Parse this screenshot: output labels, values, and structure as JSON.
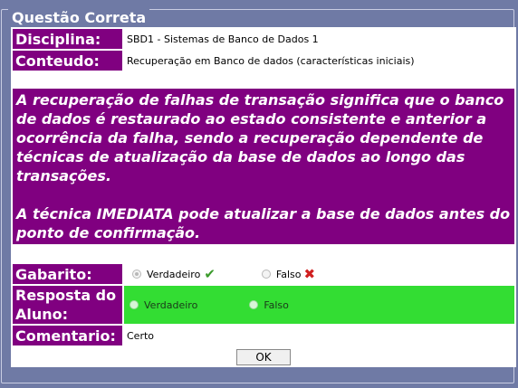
{
  "panel": {
    "title": "Questão Correta"
  },
  "fields": {
    "disciplina_label": "Disciplina:",
    "disciplina_value": "SBD1 - Sistemas de Banco de Dados 1",
    "conteudo_label": "Conteudo:",
    "conteudo_value": "Recuperação em Banco de dados (características iniciais)"
  },
  "question": {
    "paragraph1": "A recuperação de falhas de transação significa que o banco de dados é restaurado ao estado consistente e anterior a ocorrência da falha, sendo a recuperação dependente de técnicas de atualização da base de dados ao longo das transações.",
    "paragraph2": "A técnica IMEDIATA pode atualizar a base de dados antes do ponto de confirmação."
  },
  "gabarito": {
    "label": "Gabarito:",
    "options": [
      "Verdadeiro",
      "Falso"
    ],
    "selected": "Verdadeiro"
  },
  "resposta": {
    "label": "Resposta do Aluno:",
    "options": [
      "Verdadeiro",
      "Falso"
    ],
    "highlight_color": "#33dd33"
  },
  "comentario": {
    "label": "Comentario:",
    "value": "Certo"
  },
  "actions": {
    "ok_label": "OK"
  },
  "colors": {
    "label_bg": "#800080",
    "page_bg": "#6f7aa5"
  }
}
